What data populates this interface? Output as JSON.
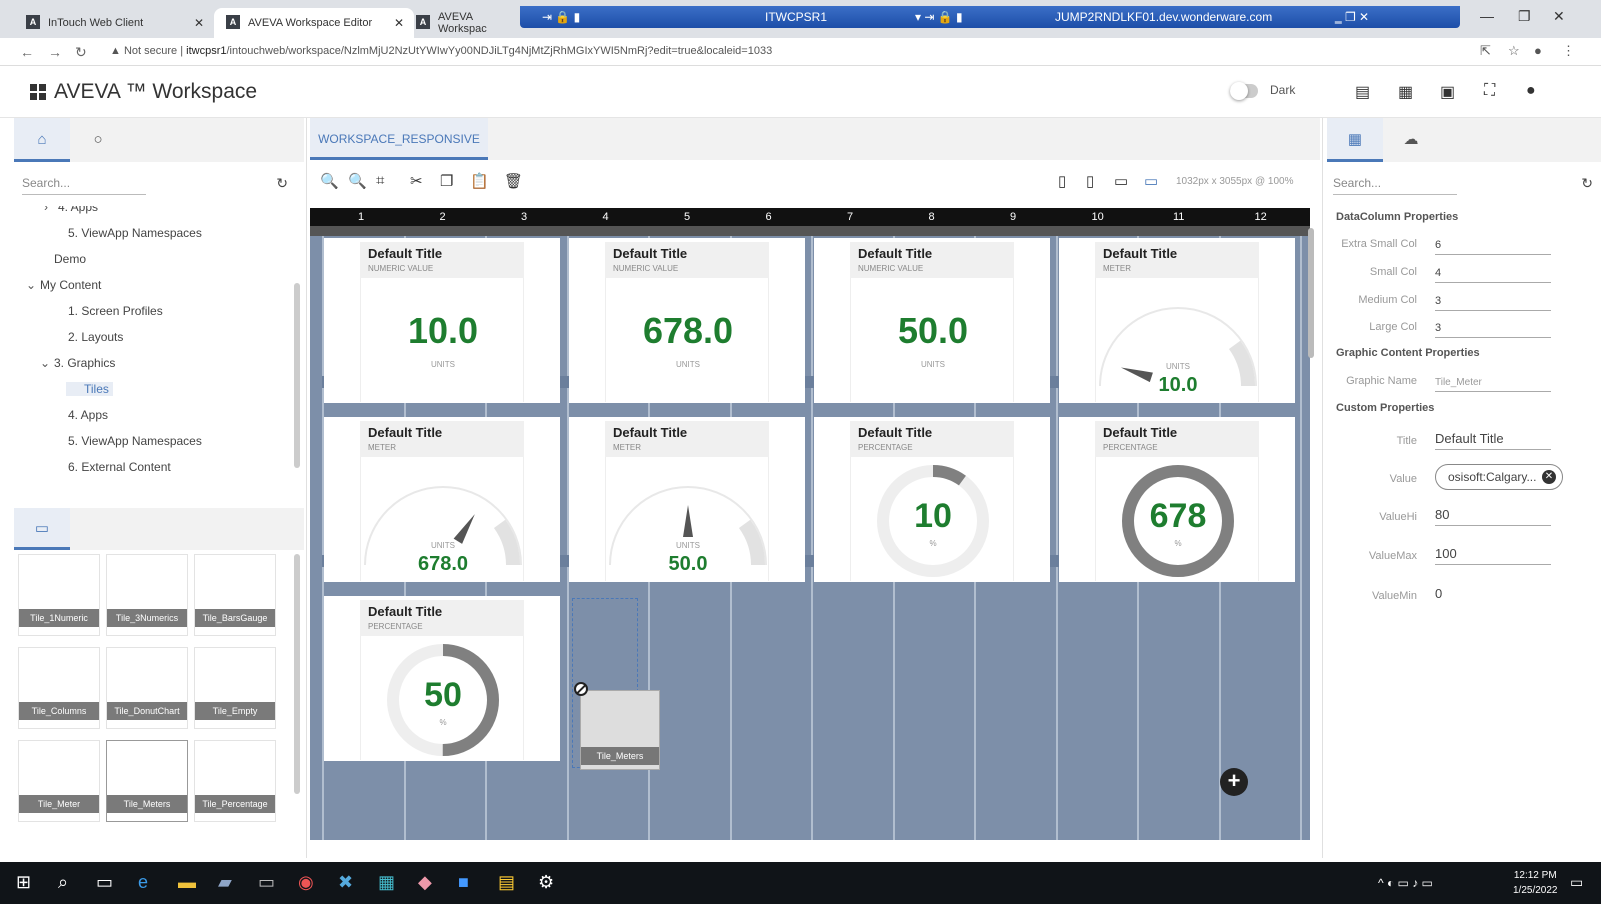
{
  "browser": {
    "tabs": [
      {
        "title": "InTouch Web Client"
      },
      {
        "title": "AVEVA Workspace Editor"
      },
      {
        "title": "AVEVA Workspac"
      }
    ],
    "rdp_host": "ITWCPSR1",
    "rdp_host2": "JUMP2RNDLKF01.dev.wonderware.com",
    "not_secure": "Not secure",
    "url_host": "itwcpsr1",
    "url_path": "/intouchweb/workspace/NzlmMjU2NzUtYWIwYy00NDJiLTg4NjMtZjRhMGIxYWI5NmRj?edit=true&localeid=1033"
  },
  "app": {
    "title": "AVEVA ™ Workspace",
    "dark_label": "Dark"
  },
  "left_panel": {
    "search_placeholder": "Search...",
    "tree": [
      {
        "label": "4. Apps",
        "chev": "›"
      },
      {
        "label": "5. ViewApp Namespaces",
        "chev": ""
      },
      {
        "label": "Demo",
        "chev": ""
      },
      {
        "label": "My Content",
        "chev": "⌄"
      },
      {
        "label": "1. Screen Profiles",
        "chev": ""
      },
      {
        "label": "2. Layouts",
        "chev": ""
      },
      {
        "label": "3. Graphics",
        "chev": "⌄"
      },
      {
        "label": "Tiles",
        "chev": ""
      },
      {
        "label": "4. Apps",
        "chev": ""
      },
      {
        "label": "5. ViewApp Namespaces",
        "chev": ""
      },
      {
        "label": "6. External Content",
        "chev": ""
      }
    ],
    "tiles": [
      "Tile_1Numeric",
      "Tile_3Numerics",
      "Tile_BarsGauge",
      "Tile_Columns",
      "Tile_DonutChart",
      "Tile_Empty",
      "Tile_Meter",
      "Tile_Meters",
      "Tile_Percentage"
    ]
  },
  "editor": {
    "tab": "WORKSPACE_RESPONSIVE",
    "dimensions": "1032px x 3055px @ 100%",
    "columns": [
      "1",
      "2",
      "3",
      "4",
      "5",
      "6",
      "7",
      "8",
      "9",
      "10",
      "11",
      "12"
    ],
    "cards": [
      {
        "title": "Default Title",
        "sub": "NUMERIC VALUE",
        "value": "10.0",
        "unit": "UNITS",
        "kind": "numeric"
      },
      {
        "title": "Default Title",
        "sub": "NUMERIC VALUE",
        "value": "678.0",
        "unit": "UNITS",
        "kind": "numeric"
      },
      {
        "title": "Default Title",
        "sub": "NUMERIC VALUE",
        "value": "50.0",
        "unit": "UNITS",
        "kind": "numeric"
      },
      {
        "title": "Default Title",
        "sub": "METER",
        "value": "10.0",
        "unit": "UNITS",
        "kind": "meter",
        "fraction": 0.1
      },
      {
        "title": "Default Title",
        "sub": "METER",
        "value": "678.0",
        "unit": "UNITS",
        "kind": "meter",
        "fraction": 0.678
      },
      {
        "title": "Default Title",
        "sub": "METER",
        "value": "50.0",
        "unit": "UNITS",
        "kind": "meter",
        "fraction": 0.5
      },
      {
        "title": "Default Title",
        "sub": "PERCENTAGE",
        "value": "10",
        "unit": "%",
        "kind": "donut",
        "fraction": 0.1
      },
      {
        "title": "Default Title",
        "sub": "PERCENTAGE",
        "value": "678",
        "unit": "%",
        "kind": "donut",
        "fraction": 1.0
      },
      {
        "title": "Default Title",
        "sub": "PERCENTAGE",
        "value": "50",
        "unit": "%",
        "kind": "donut",
        "fraction": 0.5
      }
    ],
    "drag_tile": "Tile_Meters"
  },
  "right_panel": {
    "search_placeholder": "Search...",
    "section_datacolumn": "DataColumn Properties",
    "section_graphic": "Graphic Content Properties",
    "section_custom": "Custom Properties",
    "props": {
      "xs_label": "Extra Small Col",
      "xs_value": "6",
      "sm_label": "Small Col",
      "sm_value": "4",
      "md_label": "Medium Col",
      "md_value": "3",
      "lg_label": "Large Col",
      "lg_value": "3",
      "gname_label": "Graphic Name",
      "gname_value": "Tile_Meter",
      "title_label": "Title",
      "title_value": "Default Title",
      "value_label": "Value",
      "value_value": "osisoft:Calgary...",
      "valuehi_label": "ValueHi",
      "valuehi_value": "80",
      "valuemax_label": "ValueMax",
      "valuemax_value": "100",
      "valuemin_label": "ValueMin",
      "valuemin_value": "0"
    }
  },
  "taskbar": {
    "time": "12:12 PM",
    "date": "1/25/2022"
  },
  "colors": {
    "accent": "#4a78b8",
    "value_green": "#1e7d2f",
    "canvas": "#7d8fa9"
  }
}
